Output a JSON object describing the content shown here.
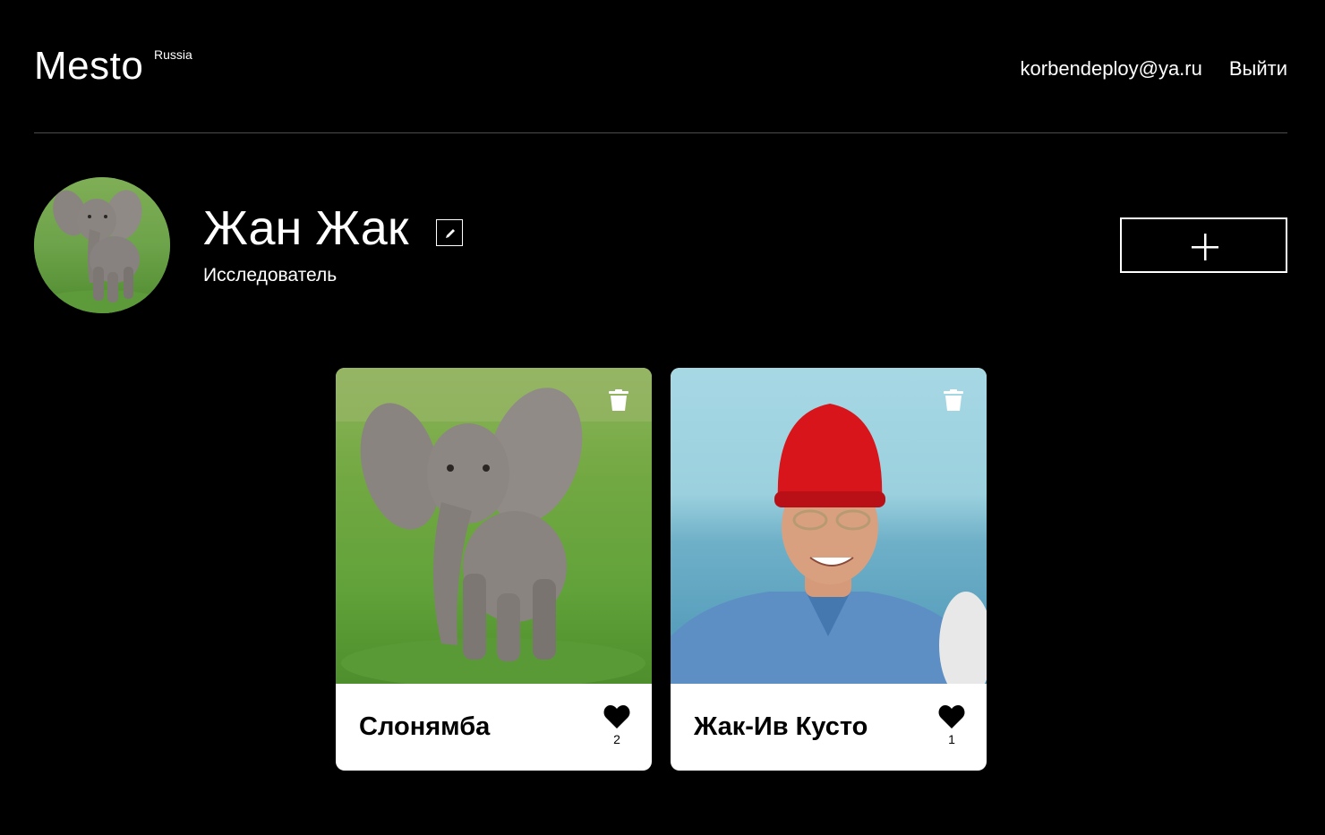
{
  "header": {
    "logo": "Mesto",
    "logo_sup": "Russia",
    "email": "korbendeploy@ya.ru",
    "logout": "Выйти"
  },
  "profile": {
    "name": "Жан Жак",
    "about": "Исследователь"
  },
  "cards": [
    {
      "title": "Слонямба",
      "likes": "2"
    },
    {
      "title": "Жак-Ив Кусто",
      "likes": "1"
    }
  ],
  "colors": {
    "background": "#000000",
    "card_background": "#ffffff",
    "divider": "#545454"
  },
  "icons": {
    "edit": "pencil-icon",
    "add": "plus-icon",
    "delete": "trash-icon",
    "like": "heart-icon"
  }
}
